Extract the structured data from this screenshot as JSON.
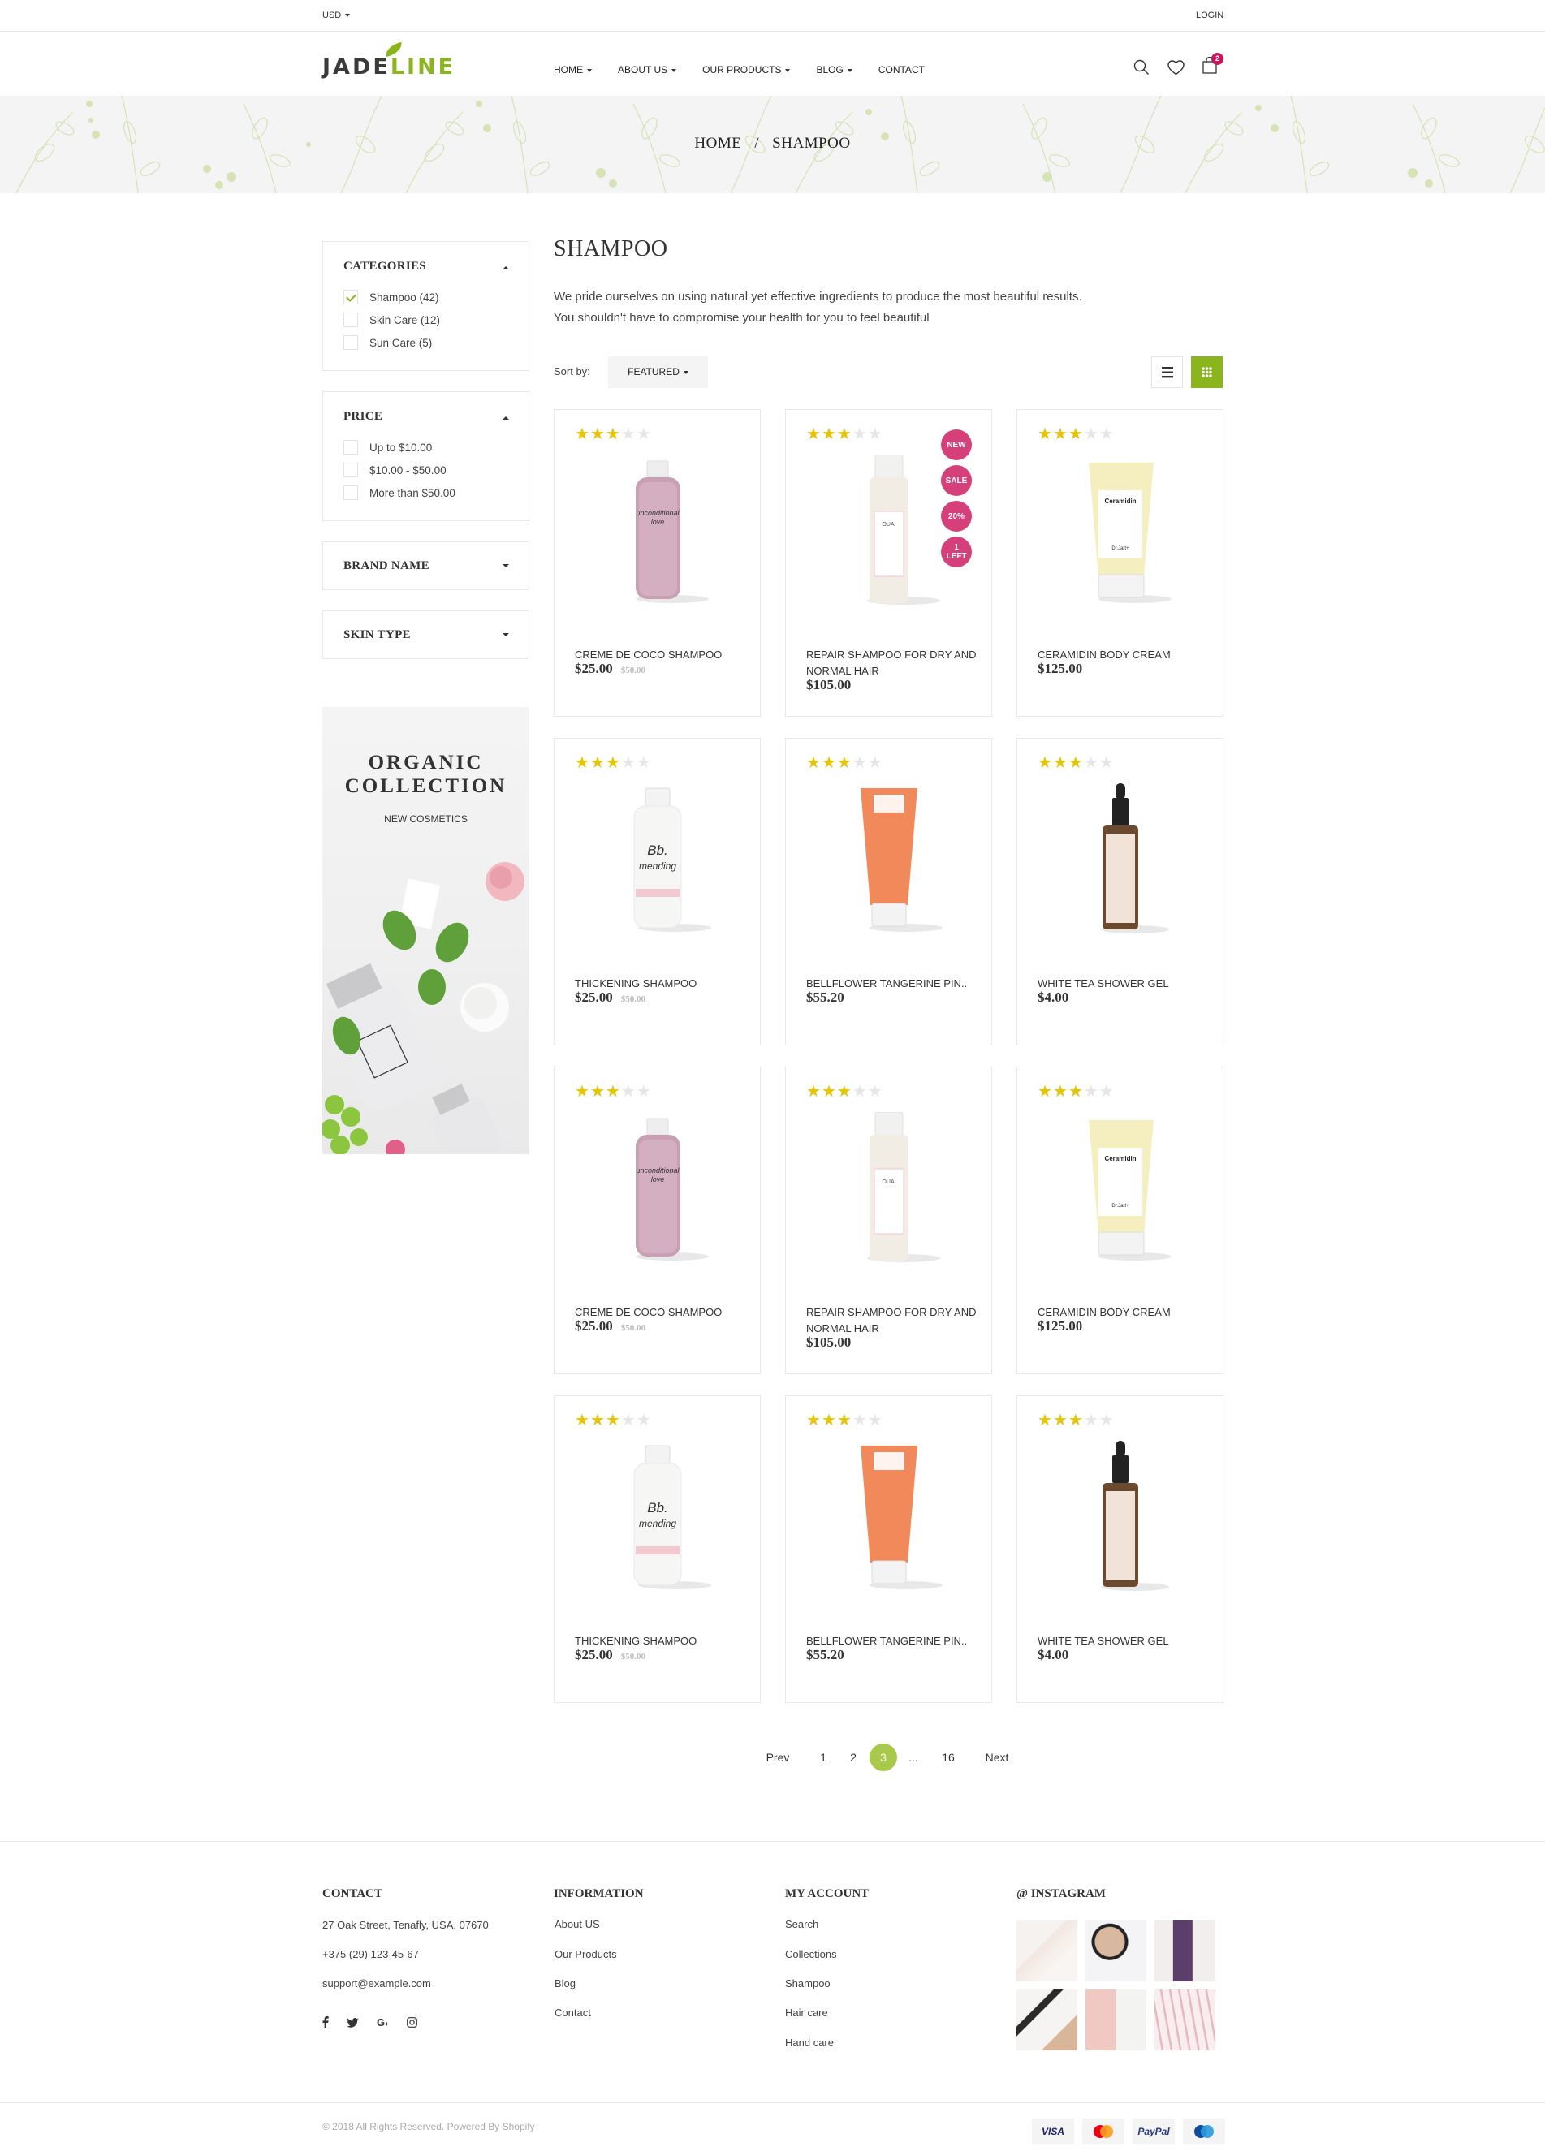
{
  "topbar": {
    "currency": "USD",
    "login": "LOGIN"
  },
  "header": {
    "logo_part1": "JADE",
    "logo_part2": "LINE",
    "nav": [
      {
        "label": "HOME",
        "has_dropdown": true
      },
      {
        "label": "ABOUT US",
        "has_dropdown": true
      },
      {
        "label": "OUR PRODUCTS",
        "has_dropdown": true
      },
      {
        "label": "BLOG",
        "has_dropdown": true
      },
      {
        "label": "CONTACT",
        "has_dropdown": false
      }
    ],
    "cart_count": "2",
    "icons": [
      "search-icon",
      "heart-icon",
      "bag-icon"
    ]
  },
  "breadcrumb": {
    "home": "HOME",
    "separator": "/",
    "current": "SHAMPOO"
  },
  "sidebar": {
    "categories": {
      "title": "CATEGORIES",
      "items": [
        {
          "label": "Shampoo (42)",
          "checked": true
        },
        {
          "label": "Skin Care (12)",
          "checked": false
        },
        {
          "label": "Sun Care (5)",
          "checked": false
        }
      ]
    },
    "price": {
      "title": "PRICE",
      "items": [
        {
          "label": "Up to $10.00",
          "checked": false
        },
        {
          "label": "$10.00 - $50.00",
          "checked": false
        },
        {
          "label": "More than $50.00",
          "checked": false
        }
      ]
    },
    "brand": {
      "title": "BRAND NAME"
    },
    "skin": {
      "title": "SKIN TYPE"
    },
    "promo": {
      "title_line1": "ORGANIC",
      "title_line2": "COLLECTION",
      "subtitle": "NEW COSMETICS"
    }
  },
  "main": {
    "title": "SHAMPOO",
    "description_line1": "We pride ourselves on using natural yet effective ingredients to produce the most beautiful results.",
    "description_line2": "You shouldn't have to compromise your health for you to feel beautiful",
    "sort_label": "Sort by:",
    "sort_value": "FEATURED",
    "view_mode": "grid",
    "products": [
      {
        "name": "CREME DE COCO SHAMPOO",
        "price": "$25.00",
        "old_price": "$50.00",
        "rating": 3,
        "image": "pink-bottle",
        "labels": []
      },
      {
        "name": "REPAIR SHAMPOO FOR DRY AND NORMAL HAIR",
        "price": "$105.00",
        "old_price": "",
        "rating": 3,
        "image": "cream-bottle",
        "labels": [
          "NEW",
          "SALE",
          "20%",
          "1 LEFT"
        ]
      },
      {
        "name": "CERAMIDIN BODY CREAM",
        "price": "$125.00",
        "old_price": "",
        "rating": 3,
        "image": "yellow-tube",
        "labels": []
      },
      {
        "name": "THICKENING SHAMPOO",
        "price": "$25.00",
        "old_price": "$50.00",
        "rating": 3,
        "image": "white-bottle",
        "labels": []
      },
      {
        "name": "BELLFLOWER TANGERINE PIN..",
        "price": "$55.20",
        "old_price": "",
        "rating": 3,
        "image": "orange-tube",
        "labels": []
      },
      {
        "name": "WHITE TEA SHOWER GEL",
        "price": "$4.00",
        "old_price": "",
        "rating": 3,
        "image": "dropper-bottle",
        "labels": []
      },
      {
        "name": "CREME DE COCO SHAMPOO",
        "price": "$25.00",
        "old_price": "$50.00",
        "rating": 3,
        "image": "pink-bottle",
        "labels": []
      },
      {
        "name": "REPAIR SHAMPOO FOR DRY AND NORMAL HAIR",
        "price": "$105.00",
        "old_price": "",
        "rating": 3,
        "image": "cream-bottle",
        "labels": []
      },
      {
        "name": "CERAMIDIN BODY CREAM",
        "price": "$125.00",
        "old_price": "",
        "rating": 3,
        "image": "yellow-tube",
        "labels": []
      },
      {
        "name": "THICKENING SHAMPOO",
        "price": "$25.00",
        "old_price": "$50.00",
        "rating": 3,
        "image": "white-bottle",
        "labels": []
      },
      {
        "name": "BELLFLOWER TANGERINE PIN..",
        "price": "$55.20",
        "old_price": "",
        "rating": 3,
        "image": "orange-tube",
        "labels": []
      },
      {
        "name": "WHITE TEA SHOWER GEL",
        "price": "$4.00",
        "old_price": "",
        "rating": 3,
        "image": "dropper-bottle",
        "labels": []
      }
    ],
    "pagination": {
      "prev": "Prev",
      "pages": [
        "1",
        "2",
        "3",
        "...",
        "16"
      ],
      "current": "3",
      "next": "Next"
    }
  },
  "footer": {
    "contact": {
      "title": "CONTACT",
      "address": "27 Oak Street, Tenafly, USA, 07670",
      "phone": "+375 (29) 123-45-67",
      "email": "support@example.com",
      "social": [
        "facebook-icon",
        "twitter-icon",
        "google-plus-icon",
        "instagram-icon"
      ]
    },
    "information": {
      "title": "INFORMATION",
      "links": [
        "About US",
        "Our Products",
        "Blog",
        "Contact"
      ]
    },
    "account": {
      "title": "MY ACCOUNT",
      "links": [
        "Search",
        "Collections",
        "Shampoo",
        "Hair care",
        "Hand care"
      ]
    },
    "instagram": {
      "title": "@ INSTAGRAM"
    },
    "copyright": "© 2018 All Rights Reserved. Powered By Shopify",
    "payments": [
      "VISA",
      "MasterCard",
      "PayPal",
      "Cirrus"
    ]
  },
  "colors": {
    "accent": "#8ab51c",
    "badge": "#c8155b",
    "label": "#d6407a",
    "star": "#e5c40a"
  }
}
